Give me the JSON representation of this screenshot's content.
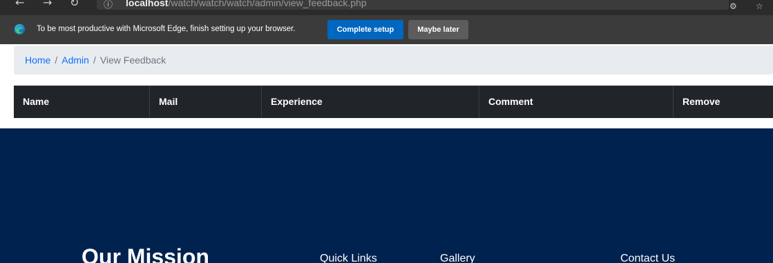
{
  "browser": {
    "url_host": "localhost",
    "url_path": "/watch/watch/watch/admin/view_feedback.php"
  },
  "edge_banner": {
    "message": "To be most productive with Microsoft Edge, finish setting up your browser.",
    "complete_label": "Complete setup",
    "later_label": "Maybe later",
    "accent": "#0067c0"
  },
  "breadcrumb": {
    "items": [
      {
        "label": "Home"
      },
      {
        "label": "Admin"
      },
      {
        "label": "View Feedback"
      }
    ],
    "separator": "/"
  },
  "table": {
    "headers": [
      "Name",
      "Mail",
      "Experience",
      "Comment",
      "Remove"
    ],
    "rows": []
  },
  "footer": {
    "mission_title": "Our Mission",
    "columns": [
      "Quick Links",
      "Gallery",
      "Contact Us"
    ],
    "background": "#00224f"
  }
}
